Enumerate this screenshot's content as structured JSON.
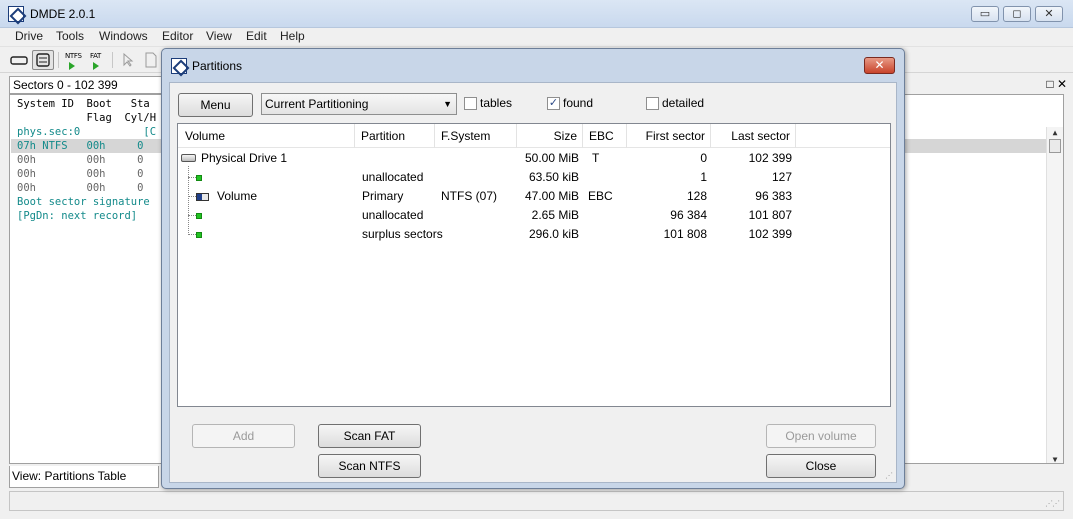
{
  "window": {
    "title": "DMDE 2.0.1",
    "controls": {
      "minimize": "▭",
      "maximize": "◻",
      "close": "✕"
    }
  },
  "menubar": [
    "Drive",
    "Tools",
    "Windows",
    "Editor",
    "View",
    "Edit",
    "Help"
  ],
  "toolbar": {
    "ntfs_label": "NTFS",
    "fat_label": "FAT"
  },
  "left_pane": {
    "header": "Sectors 0 - 102 399",
    "pane_controls": "□ ✕",
    "lines": [
      "System ID  Boot   Sta",
      "           Flag  Cyl/H",
      "phys.sec:0          [C",
      "07h NTFS   00h     0",
      "00h        00h     0",
      "00h        00h     0",
      "00h        00h     0",
      "Boot sector signature",
      "[PgDn: next record]"
    ],
    "view_label": "View: Partitions Table"
  },
  "dialog": {
    "title": "Partitions",
    "close_glyph": "✕",
    "menu_button": "Menu",
    "combo_value": "Current Partitioning",
    "checkboxes": [
      {
        "label": "tables",
        "checked": false
      },
      {
        "label": "found",
        "checked": true
      },
      {
        "label": "detailed",
        "checked": false
      }
    ],
    "columns": [
      "Volume",
      "Partition",
      "F.System",
      "Size",
      "EBC",
      "First sector",
      "Last sector"
    ],
    "rows": [
      {
        "volume": "Physical Drive 1",
        "partition": "",
        "fs": "",
        "size": "50.00 MiB",
        "ebc": "T",
        "first": "0",
        "last": "102 399"
      },
      {
        "volume": "",
        "partition": "unallocated",
        "fs": "",
        "size": "63.50 kiB",
        "ebc": "",
        "first": "1",
        "last": "127"
      },
      {
        "volume": "Volume",
        "partition": "Primary",
        "fs": "NTFS (07)",
        "size": "47.00 MiB",
        "ebc": "EBC",
        "first": "128",
        "last": "96 383"
      },
      {
        "volume": "",
        "partition": "unallocated",
        "fs": "",
        "size": "2.65 MiB",
        "ebc": "",
        "first": "96 384",
        "last": "101 807"
      },
      {
        "volume": "",
        "partition": "surplus sectors",
        "fs": "",
        "size": "296.0 kiB",
        "ebc": "",
        "first": "101 808",
        "last": "102 399"
      }
    ],
    "buttons": {
      "add": "Add",
      "scan_fat": "Scan FAT",
      "scan_ntfs": "Scan NTFS",
      "open_volume": "Open volume",
      "close": "Close"
    }
  }
}
